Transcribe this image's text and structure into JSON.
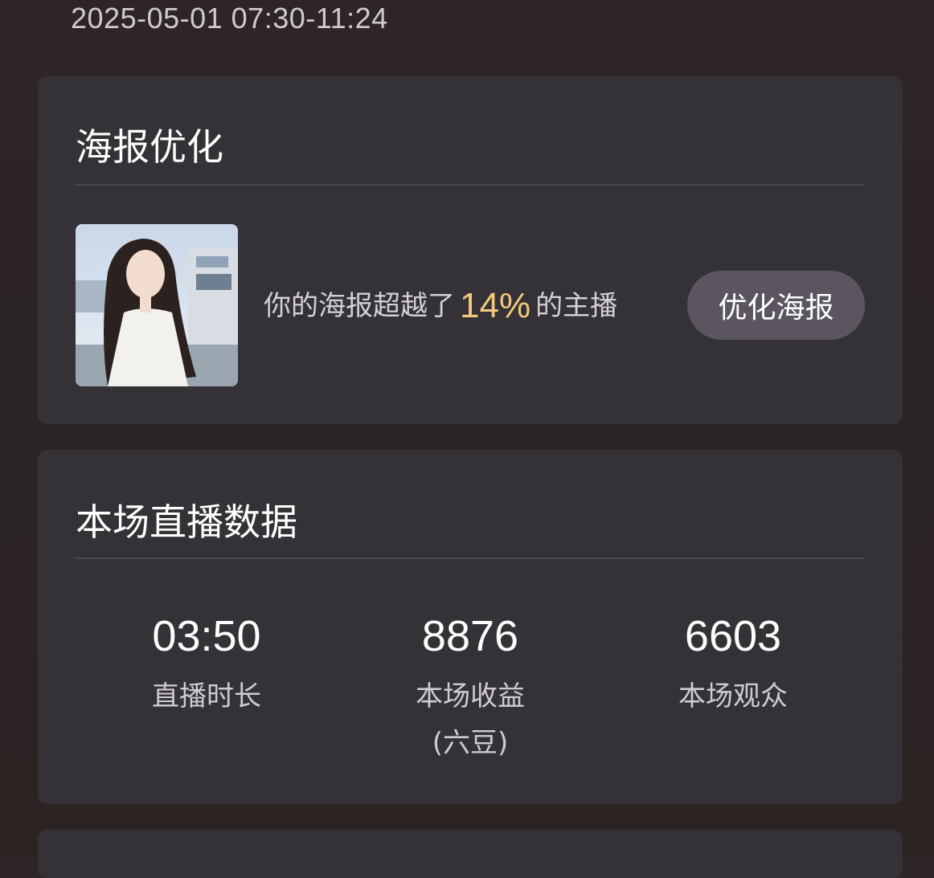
{
  "header": {
    "time_range": "2025-05-01 07:30-11:24"
  },
  "poster_card": {
    "title": "海报优化",
    "text_prefix": "你的海报超越了",
    "percent": "14%",
    "text_suffix": "的主播",
    "button_label": "优化海报"
  },
  "stats_card": {
    "title": "本场直播数据",
    "items": [
      {
        "value": "03:50",
        "label": "直播时长",
        "label2": ""
      },
      {
        "value": "8876",
        "label": "本场收益",
        "label2": "(六豆)"
      },
      {
        "value": "6603",
        "label": "本场观众",
        "label2": ""
      }
    ]
  },
  "colors": {
    "background": "#2c2425",
    "card": "#353237",
    "accent_percent": "#f2c97b",
    "button": "#5b5560"
  }
}
